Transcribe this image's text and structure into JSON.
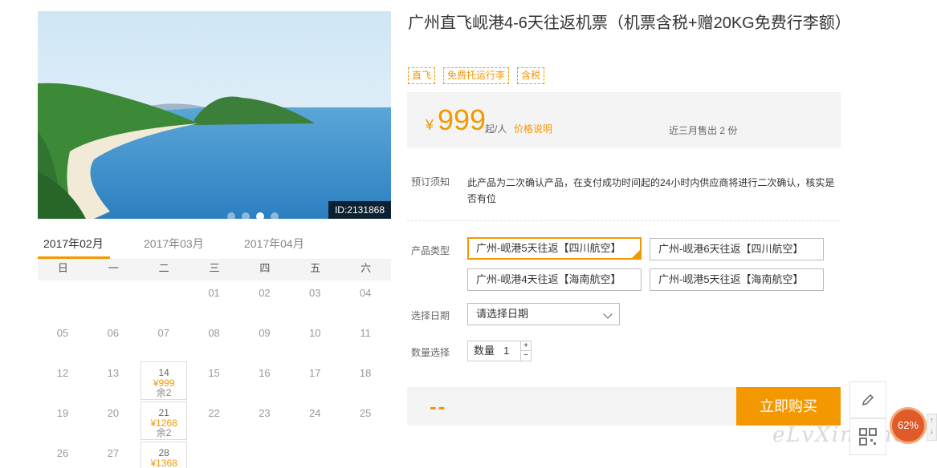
{
  "photo": {
    "id_label": "ID:2131868",
    "slides": [
      false,
      false,
      true,
      false
    ]
  },
  "calendar": {
    "tabs": [
      "2017年02月",
      "2017年03月",
      "2017年04月"
    ],
    "active_tab": 0,
    "weekdays": [
      "日",
      "一",
      "二",
      "三",
      "四",
      "五",
      "六"
    ],
    "days": [
      {
        "row": 0,
        "col": 3,
        "day": "01"
      },
      {
        "row": 0,
        "col": 4,
        "day": "02"
      },
      {
        "row": 0,
        "col": 5,
        "day": "03"
      },
      {
        "row": 0,
        "col": 6,
        "day": "04"
      },
      {
        "row": 1,
        "col": 0,
        "day": "05"
      },
      {
        "row": 1,
        "col": 1,
        "day": "06"
      },
      {
        "row": 1,
        "col": 2,
        "day": "07"
      },
      {
        "row": 1,
        "col": 3,
        "day": "08"
      },
      {
        "row": 1,
        "col": 4,
        "day": "09"
      },
      {
        "row": 1,
        "col": 5,
        "day": "10"
      },
      {
        "row": 1,
        "col": 6,
        "day": "11"
      },
      {
        "row": 2,
        "col": 0,
        "day": "12"
      },
      {
        "row": 2,
        "col": 1,
        "day": "13"
      },
      {
        "row": 2,
        "col": 2,
        "day": "14",
        "price": "¥999",
        "remain": "余2"
      },
      {
        "row": 2,
        "col": 3,
        "day": "15"
      },
      {
        "row": 2,
        "col": 4,
        "day": "16"
      },
      {
        "row": 2,
        "col": 5,
        "day": "17"
      },
      {
        "row": 2,
        "col": 6,
        "day": "18"
      },
      {
        "row": 3,
        "col": 0,
        "day": "19"
      },
      {
        "row": 3,
        "col": 1,
        "day": "20"
      },
      {
        "row": 3,
        "col": 2,
        "day": "21",
        "price": "¥1268",
        "remain": "余2"
      },
      {
        "row": 3,
        "col": 3,
        "day": "22"
      },
      {
        "row": 3,
        "col": 4,
        "day": "23"
      },
      {
        "row": 3,
        "col": 5,
        "day": "24"
      },
      {
        "row": 3,
        "col": 6,
        "day": "25"
      },
      {
        "row": 4,
        "col": 0,
        "day": "26"
      },
      {
        "row": 4,
        "col": 1,
        "day": "27"
      },
      {
        "row": 4,
        "col": 2,
        "day": "28",
        "price": "¥1368",
        "remain": ""
      }
    ]
  },
  "product": {
    "title": "广州直飞岘港4-6天往返机票（机票含税+赠20KG免费行李额）",
    "tags": [
      "直飞",
      "免费托运行李",
      "含税"
    ],
    "currency": "¥",
    "price": "999",
    "price_unit": "起/人",
    "price_note": "价格说明",
    "sold": "近三月售出 2 份"
  },
  "booking": {
    "notice_label": "预订须知",
    "notice_text": "此产品为二次确认产品，在支付成功时间起的24小时内供应商将进行二次确认，核实是否有位",
    "type_label": "产品类型",
    "types": [
      {
        "label": "广州-岘港5天往返【四川航空】",
        "selected": true
      },
      {
        "label": "广州-岘港6天往返【四川航空】",
        "selected": false
      },
      {
        "label": "广州-岘港4天往返【海南航空】",
        "selected": false
      },
      {
        "label": "广州-岘港5天往返【海南航空】",
        "selected": false
      }
    ],
    "date_label": "选择日期",
    "date_placeholder": "请选择日期",
    "qty_label": "数量选择",
    "qty_prefix": "数量",
    "qty_value": "1",
    "qty_up": "+",
    "qty_down": "−",
    "total": "--",
    "buy_label": "立即购买"
  },
  "sidebar": {
    "percent": "62%"
  },
  "watermark": "eLvXing.net",
  "colors": {
    "accent": "#f39800",
    "panel": "#f4f4f4"
  }
}
